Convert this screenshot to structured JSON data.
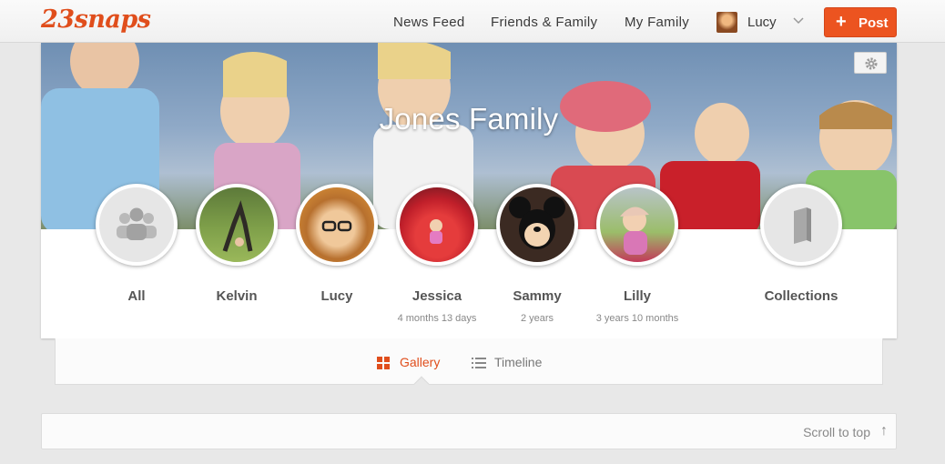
{
  "app": {
    "logo": "23snaps"
  },
  "nav": {
    "items": [
      "News Feed",
      "Friends & Family",
      "My Family"
    ],
    "user_name": "Lucy",
    "post_label": "Post"
  },
  "family": {
    "title": "Jones Family",
    "members": [
      {
        "name": "All",
        "age": ""
      },
      {
        "name": "Kelvin",
        "age": ""
      },
      {
        "name": "Lucy",
        "age": ""
      },
      {
        "name": "Jessica",
        "age": "4 months 13 days"
      },
      {
        "name": "Sammy",
        "age": "2 years"
      },
      {
        "name": "Lilly",
        "age": "3 years 10 months"
      },
      {
        "name": "Collections",
        "age": ""
      }
    ]
  },
  "tabs": {
    "gallery": "Gallery",
    "timeline": "Timeline",
    "active": "gallery"
  },
  "footer": {
    "scroll_top": "Scroll to top",
    "scroll_arrow": "↑"
  },
  "colors": {
    "accent": "#ec5420",
    "brand": "#e04e1c"
  }
}
